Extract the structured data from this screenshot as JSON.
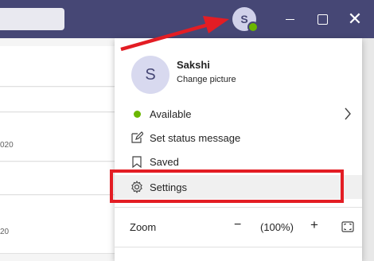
{
  "titlebar": {
    "avatar_initial": "S",
    "bg_color": "#464775",
    "status_color": "#6bb700"
  },
  "left_panel": {
    "dates": [
      "020",
      "20"
    ]
  },
  "profile": {
    "initial": "S",
    "name": "Sakshi",
    "change_picture": "Change picture"
  },
  "menu": {
    "available": "Available",
    "set_status": "Set status message",
    "saved": "Saved",
    "settings": "Settings"
  },
  "zoom": {
    "label": "Zoom",
    "minus": "−",
    "value": "(100%)",
    "plus": "+"
  },
  "annotation": {
    "highlight_color": "#e31d24"
  }
}
